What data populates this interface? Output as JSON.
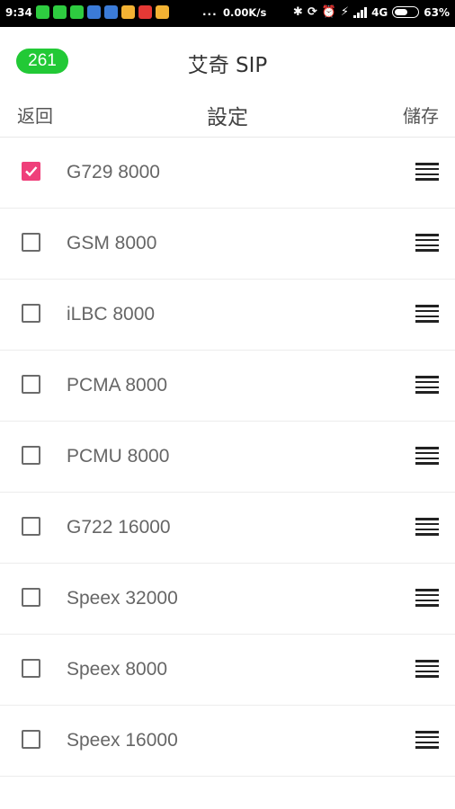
{
  "status_bar": {
    "time": "9:34",
    "dots": "...",
    "net_speed": "0.00K/s",
    "network": "4G",
    "battery": "63%",
    "battery_level": 0.63,
    "notification_icon_colors": [
      "#2ecc40",
      "#2ecc40",
      "#2ecc40",
      "#3b7bd8",
      "#3b7bd8",
      "#f2b233",
      "#e53935",
      "#f2b233"
    ]
  },
  "header": {
    "badge": "261",
    "badge_color": "#22c936",
    "app_title": "艾奇 SIP"
  },
  "nav": {
    "back_label": "返回",
    "title": "設定",
    "save_label": "儲存"
  },
  "accent_color": "#ef3f7a",
  "codecs": [
    {
      "label": "G729 8000",
      "checked": true
    },
    {
      "label": "GSM 8000",
      "checked": false
    },
    {
      "label": "iLBC 8000",
      "checked": false
    },
    {
      "label": "PCMA 8000",
      "checked": false
    },
    {
      "label": "PCMU 8000",
      "checked": false
    },
    {
      "label": "G722 16000",
      "checked": false
    },
    {
      "label": "Speex 32000",
      "checked": false
    },
    {
      "label": "Speex 8000",
      "checked": false
    },
    {
      "label": "Speex 16000",
      "checked": false
    }
  ]
}
